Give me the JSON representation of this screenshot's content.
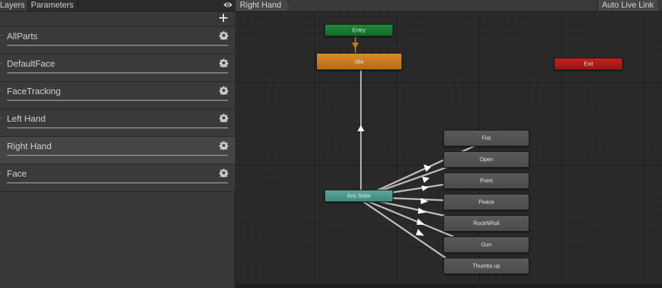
{
  "left_panel": {
    "tabs": {
      "layers": "Layers",
      "parameters": "Parameters"
    },
    "layers": [
      {
        "name": "AllParts",
        "selected": false
      },
      {
        "name": "DefaultFace",
        "selected": false
      },
      {
        "name": "FaceTracking",
        "selected": false
      },
      {
        "name": "Left Hand",
        "selected": false
      },
      {
        "name": "Right Hand",
        "selected": true
      },
      {
        "name": "Face",
        "selected": false
      }
    ]
  },
  "graph": {
    "breadcrumb": "Right Hand",
    "live_link": "Auto Live Link",
    "states": {
      "entry": "Entry",
      "idle": "Idle",
      "exit": "Exit",
      "any_state": "Any State",
      "fist": "Fist",
      "open": "Open",
      "point": "Point",
      "peace": "Peace",
      "rocknroll": "RockNRoll",
      "gun": "Gun",
      "thumbs_up": "Thumbs up"
    },
    "colors": {
      "entry": "#1f8a38",
      "idle": "#d98a2a",
      "exit": "#c31f1f",
      "any_state": "#5aa79a",
      "state": "#555555"
    }
  }
}
